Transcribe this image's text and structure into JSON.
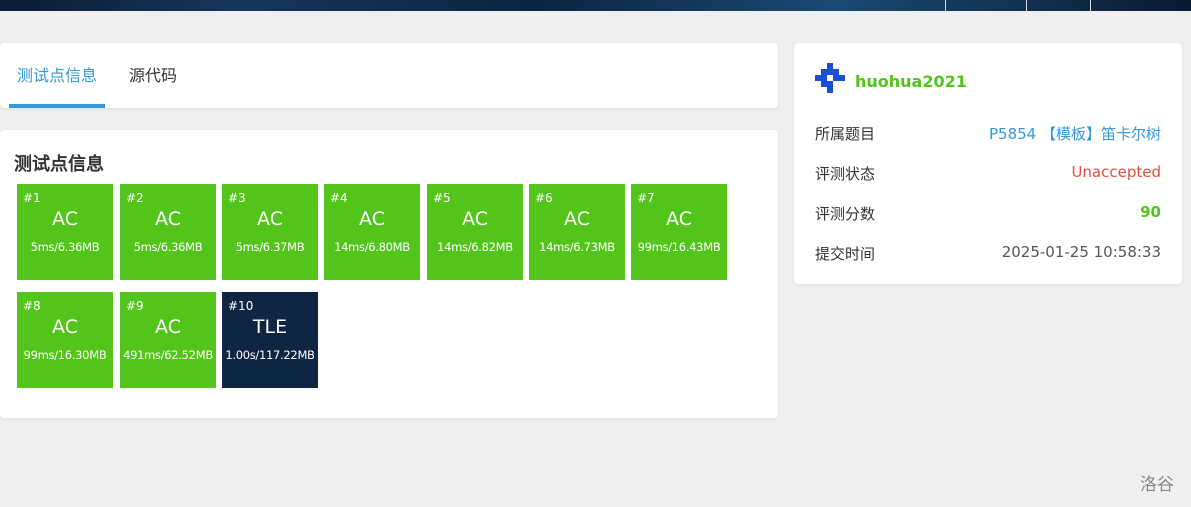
{
  "tabs": [
    {
      "label": "测试点信息",
      "active": true
    },
    {
      "label": "源代码",
      "active": false
    }
  ],
  "section_title": "测试点信息",
  "testcases": [
    {
      "num": "#1",
      "status": "AC",
      "meta": "5ms/6.36MB"
    },
    {
      "num": "#2",
      "status": "AC",
      "meta": "5ms/6.36MB"
    },
    {
      "num": "#3",
      "status": "AC",
      "meta": "5ms/6.37MB"
    },
    {
      "num": "#4",
      "status": "AC",
      "meta": "14ms/6.80MB"
    },
    {
      "num": "#5",
      "status": "AC",
      "meta": "14ms/6.82MB"
    },
    {
      "num": "#6",
      "status": "AC",
      "meta": "14ms/6.73MB"
    },
    {
      "num": "#7",
      "status": "AC",
      "meta": "99ms/16.43MB"
    },
    {
      "num": "#8",
      "status": "AC",
      "meta": "99ms/16.30MB"
    },
    {
      "num": "#9",
      "status": "AC",
      "meta": "491ms/62.52MB"
    },
    {
      "num": "#10",
      "status": "TLE",
      "meta": "1.00s/117.22MB"
    }
  ],
  "submission": {
    "username": "huohua2021",
    "rows": [
      {
        "label": "所属题目",
        "value": "P5854 【模板】笛卡尔树"
      },
      {
        "label": "评测状态",
        "value": "Unaccepted"
      },
      {
        "label": "评测分数",
        "value": "90"
      },
      {
        "label": "提交时间",
        "value": "2025-01-25 10:58:33"
      }
    ]
  },
  "footer": {
    "brand": "洛谷"
  },
  "colors": {
    "accepted": "#52c41a",
    "tle": "#0e2544",
    "link": "#3498db",
    "error": "#e74c3c"
  }
}
